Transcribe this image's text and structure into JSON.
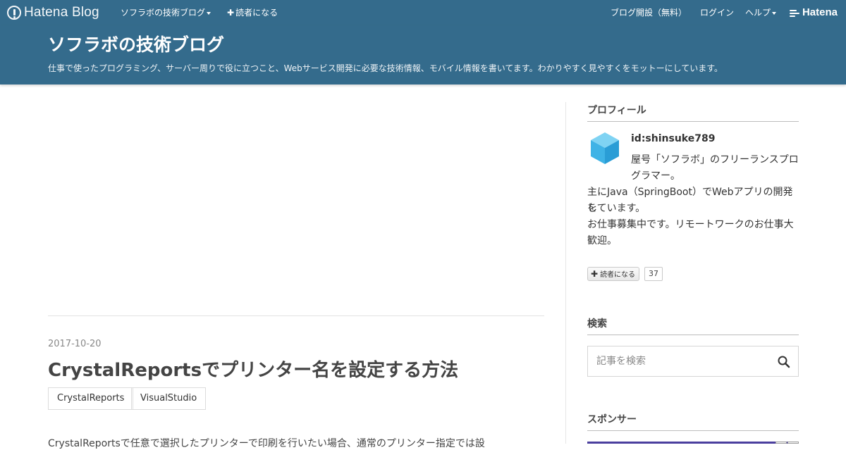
{
  "topbar": {
    "logo_text": "Hatena Blog",
    "blog_menu": "ソフラボの技術ブログ",
    "subscribe": "読者になる",
    "open_blog": "ブログ開設（無料）",
    "login": "ログイン",
    "help": "ヘルプ",
    "hatena": "Hatena"
  },
  "header": {
    "title": "ソフラボの技術ブログ",
    "description": "仕事で使ったプログラミング、サーバー周りで役に立つこと、Webサービス開発に必要な技術情報、モバイル情報を書いてます。わかりやすく見やすくをモットーにしています。"
  },
  "post": {
    "date": "2017-10-20",
    "title": "CrystalReportsでプリンター名を設定する方法",
    "tags": [
      "CrystalReports",
      "VisualStudio"
    ],
    "body_start": "CrystalReportsで任意で選択したプリンターで印刷を行いたい場合、通常のプリンター指定では設"
  },
  "sidebar": {
    "profile_heading": "プロフィール",
    "profile_id": "id:shinsuke789",
    "profile_line1": "屋号「ソフラボ」のフリーランスプロ",
    "profile_line2": "グラマー。",
    "profile_line3": "主にJava（SpringBoot）でWebアプリの開発を",
    "profile_line4": "しています。",
    "profile_line5": "お仕事募集中です。リモートワークのお仕事大",
    "profile_line6": "歓迎。",
    "subscribe_label": "読者になる",
    "subscriber_count": "37",
    "search_heading": "検索",
    "search_placeholder": "記事を検索",
    "sponsor_heading": "スポンサー"
  },
  "colors": {
    "header_bg": "#346b8c",
    "avatar": "#3fb3e6",
    "sponsor_bar": "#4b3f9e"
  },
  "icons": [
    "hatena-blog-logo-icon",
    "caret-down-icon",
    "plus-icon",
    "hatena-logo-icon",
    "cube-avatar-icon",
    "search-icon"
  ]
}
